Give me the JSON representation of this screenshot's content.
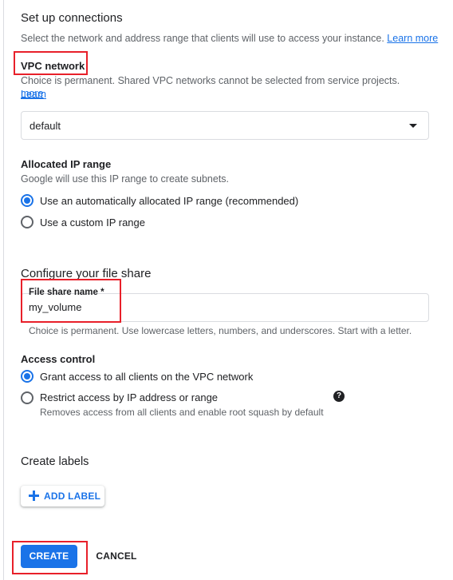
{
  "connections": {
    "title": "Set up connections",
    "description": "Select the network and address range that clients will use to access your instance.",
    "learn_more": "Learn more"
  },
  "vpc": {
    "label": "VPC network",
    "description": "Choice is permanent. Shared VPC networks cannot be selected from service projects.",
    "learn_more_line1": "Learn",
    "learn_more_line2": "more",
    "selected_value": "default"
  },
  "ip_range": {
    "label": "Allocated IP range",
    "description": "Google will use this IP range to create subnets.",
    "options": [
      {
        "label": "Use an automatically allocated IP range (recommended)",
        "checked": true
      },
      {
        "label": "Use a custom IP range",
        "checked": false
      }
    ]
  },
  "file_share": {
    "title": "Configure your file share",
    "name_label": "File share name *",
    "name_value": "my_volume",
    "hint": "Choice is permanent. Use lowercase letters, numbers, and underscores. Start with a letter."
  },
  "access_control": {
    "label": "Access control",
    "options": [
      {
        "label": "Grant access to all clients on the VPC network",
        "checked": true
      },
      {
        "label": "Restrict access by IP address or range",
        "checked": false,
        "hint": "Removes access from all clients and enable root squash by default"
      }
    ],
    "help_icon": "?"
  },
  "labels": {
    "title": "Create labels",
    "add_button": "ADD LABEL"
  },
  "actions": {
    "create": "CREATE",
    "cancel": "CANCEL"
  },
  "colors": {
    "accent": "#1a73e8",
    "highlight": "#e8202a"
  }
}
